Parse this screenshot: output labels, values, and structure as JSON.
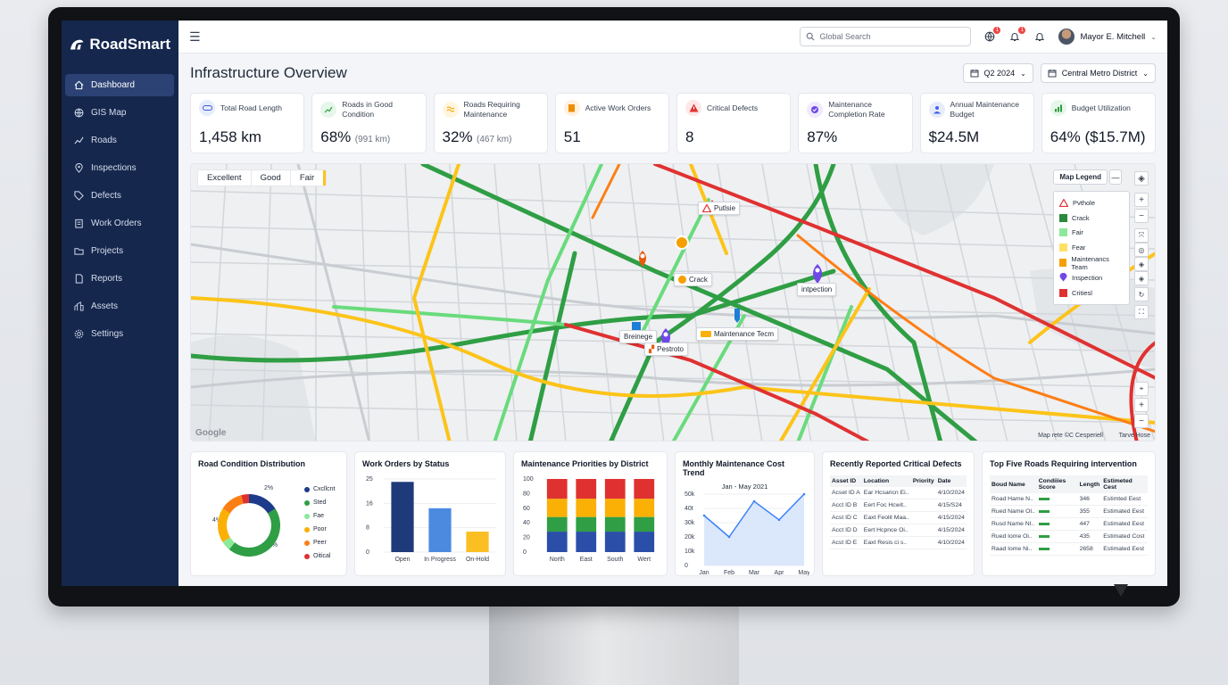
{
  "app": {
    "name": "RoadSmart"
  },
  "sidebar": {
    "items": [
      {
        "label": "Dashboard",
        "icon": "home-icon",
        "active": true
      },
      {
        "label": "GIS Map",
        "icon": "globe-icon"
      },
      {
        "label": "Roads",
        "icon": "route-icon"
      },
      {
        "label": "Inspections",
        "icon": "location-pin-icon"
      },
      {
        "label": "Defects",
        "icon": "tag-icon"
      },
      {
        "label": "Work Orders",
        "icon": "clipboard-icon"
      },
      {
        "label": "Projects",
        "icon": "folder-icon"
      },
      {
        "label": "Reports",
        "icon": "document-icon"
      },
      {
        "label": "Assets",
        "icon": "assets-icon"
      },
      {
        "label": "Settings",
        "icon": "gear-icon"
      }
    ]
  },
  "topbar": {
    "search_placeholder": "Global Search",
    "globe_badge": "1",
    "alert_badge": "1",
    "user_name": "Mayor E. Mitchell"
  },
  "header": {
    "title": "Infrastructure Overview",
    "period": "Q2 2024",
    "district": "Central Metro District"
  },
  "kpis": [
    {
      "label": "Total Road Length",
      "value": "1,458 km",
      "sub": "",
      "color": "#3b5bdb"
    },
    {
      "label": "Roads in Good Condition",
      "value": "68%",
      "sub": "(991 km)",
      "color": "#2f9e44"
    },
    {
      "label": "Roads Requiring Maintenance",
      "value": "32%",
      "sub": "(467 km)",
      "color": "#f59f00"
    },
    {
      "label": "Active Work Orders",
      "value": "51",
      "sub": "",
      "color": "#f08c00"
    },
    {
      "label": "Critical Defects",
      "value": "8",
      "sub": "",
      "color": "#e03131"
    },
    {
      "label": "Maintenance Completion Rate",
      "value": "87%",
      "sub": "",
      "color": "#7048e8"
    },
    {
      "label": "Annual Maintenance Budget",
      "value": "$24.5M",
      "sub": "",
      "color": "#4263eb"
    },
    {
      "label": "Budget Utilization",
      "value": "64% ($15.7M)",
      "sub": "",
      "color": "#2f9e44"
    }
  ],
  "map": {
    "condition_filters": [
      "Excellent",
      "Good",
      "Fair"
    ],
    "legend_title": "Map Legend",
    "legend": [
      {
        "label": "Pvthole",
        "color": "#e03131",
        "shape": "triangle"
      },
      {
        "label": "Crack",
        "color": "#2b8a3e",
        "shape": "square"
      },
      {
        "label": "Fair",
        "color": "#8ce99a",
        "shape": "square"
      },
      {
        "label": "Fear",
        "color": "#ffe066",
        "shape": "square"
      },
      {
        "label": "Maintenancs Team",
        "color": "#f59f00",
        "shape": "square"
      },
      {
        "label": "Inspection",
        "color": "#7048e8",
        "shape": "pin"
      },
      {
        "label": "Critiesl",
        "color": "#e03131",
        "shape": "square"
      }
    ],
    "markers": [
      {
        "label": "Putlsie",
        "kind": "pothole"
      },
      {
        "label": "Crack",
        "kind": "crack"
      },
      {
        "label": "intpection",
        "kind": "inspection"
      },
      {
        "label": "Breinege",
        "kind": "drainage"
      },
      {
        "label": "Pestroto",
        "kind": "pothole"
      },
      {
        "label": "Maintenance Tecm",
        "kind": "team"
      }
    ],
    "attribution": "Map rete ©C Cesperiell",
    "terms": "Tarve Hose",
    "google": "Google"
  },
  "road_condition": {
    "title": "Road Condition Distribution",
    "segment_labels": [
      "4%",
      "2%",
      "2%"
    ],
    "legend": [
      {
        "label": "Cxcllcnt",
        "color": "#1e3a8a"
      },
      {
        "label": "Sted",
        "color": "#2f9e44"
      },
      {
        "label": "Fae",
        "color": "#8ce99a"
      },
      {
        "label": "Poor",
        "color": "#fab005"
      },
      {
        "label": "Peer",
        "color": "#fd7e14"
      },
      {
        "label": "Oitical",
        "color": "#e03131"
      }
    ]
  },
  "chart_data": [
    {
      "type": "pie",
      "title": "Road Condition Distribution",
      "categories": [
        "Cxcllcnt",
        "Sted",
        "Fae",
        "Poor",
        "Peer",
        "Oitical"
      ],
      "values": [
        16,
        45,
        5,
        18,
        12,
        4
      ]
    },
    {
      "type": "bar",
      "title": "Work Orders by Status",
      "categories": [
        "Open",
        "In Progress",
        "On-Hold"
      ],
      "values": [
        24,
        15,
        7
      ],
      "ylim": [
        0,
        25
      ],
      "yticks": [
        "25",
        "16",
        "8",
        "0"
      ],
      "colors": [
        "#1e3a7a",
        "#4c8ae0",
        "#fbbf24"
      ]
    },
    {
      "type": "bar",
      "title": "Maintenance Priorities by District",
      "categories": [
        "North",
        "East",
        "South",
        "Wert"
      ],
      "series": [
        {
          "values": [
            28,
            28,
            28,
            28
          ],
          "color": "#2b4fa8"
        },
        {
          "values": [
            20,
            20,
            20,
            20
          ],
          "color": "#2f9e44"
        },
        {
          "values": [
            25,
            25,
            25,
            25
          ],
          "color": "#fab005"
        },
        {
          "values": [
            27,
            27,
            27,
            27
          ],
          "color": "#e03131"
        }
      ],
      "ylim": [
        0,
        100
      ],
      "yticks": [
        "100",
        "80",
        "60",
        "40",
        "20",
        "0"
      ]
    },
    {
      "type": "area",
      "title": "Monthly Maintenance Cost Trend",
      "subtitle": "Jan - May 2021",
      "x": [
        "Jan",
        "Feb",
        "Mar",
        "Apr",
        "May"
      ],
      "values": [
        35,
        20,
        45,
        32,
        50
      ],
      "ylim": [
        0,
        50
      ],
      "yticks": [
        "50k",
        "40t",
        "30k",
        "20k",
        "10k",
        "0"
      ]
    }
  ],
  "defects": {
    "title": "Recently Reported Critical Defects",
    "columns": [
      "Asset ID",
      "Location",
      "Priority",
      "Date"
    ],
    "rows": [
      [
        "Acset ID A",
        "Ear Hcsaricn Ei..",
        "",
        "4/10/2024"
      ],
      [
        "Acct ID B",
        "Eert Foc Hcwit..",
        "",
        "4/15/S24"
      ],
      [
        "Acst ID C",
        "Eaxt Feolit Maa..",
        "",
        "4/15/2024"
      ],
      [
        "Acct ID D",
        "Eert Hcpnce Oi..",
        "",
        "4/15/2024"
      ],
      [
        "Acst ID E",
        "Eaxt Resis ci s..",
        "",
        "4/10/2024"
      ]
    ]
  },
  "top_roads": {
    "title": "Top Five Roads Requiring intervention",
    "columns": [
      "Boud Name",
      "Condiiies Score",
      "Length",
      "Estimeted Cest"
    ],
    "rows": [
      [
        "Road Hame N..",
        "",
        "346",
        "Estimted Eest"
      ],
      [
        "Rued Name Ol..",
        "",
        "355",
        "Estimated Eest"
      ],
      [
        "Rusd Name Nl..",
        "",
        "447",
        "Estimated Eest"
      ],
      [
        "Rued Iome Oi..",
        "",
        "435",
        "Estimated Cost"
      ],
      [
        "Raad Iome Ni..",
        "",
        "2658",
        "Estimated Eest"
      ]
    ],
    "score_color": "#2f9e44"
  }
}
